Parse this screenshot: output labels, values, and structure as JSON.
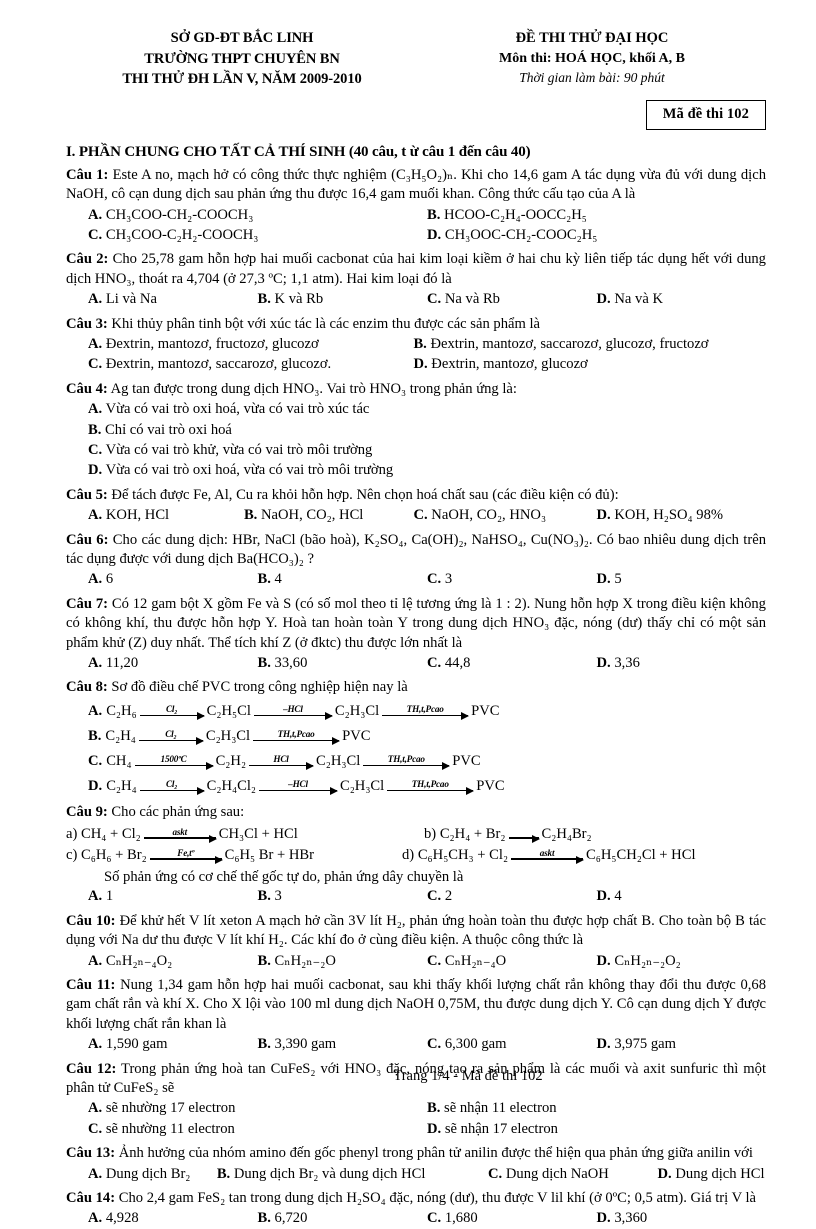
{
  "header": {
    "left": [
      "SỞ GD-ĐT BẮC LINH",
      "TRƯỜNG THPT CHUYÊN BN",
      "THI THỬ ĐH LẦN V, NĂM 2009-2010"
    ],
    "right_title": "ĐỀ THI THỬ ĐẠI HỌC",
    "right_subject": "Môn thi: HOÁ HỌC, khối A, B",
    "right_time": "Thời gian làm bài: 90 phút",
    "exam_code": "Mã đề thi 102"
  },
  "section_title": "I. PHẦN CHUNG CHO TẤT CẢ THÍ SINH (40 câu, t ừ câu 1 đến câu 40)",
  "questions": [
    {
      "label": "Câu 1:",
      "stem": "Este A no, mạch hở có công thức thực nghiệm (C₃H₅O₂)ₙ. Khi cho 14,6 gam A tác dụng vừa đủ với dung dịch NaOH, cô cạn dung dịch sau phản ứng thu được 16,4 gam muối khan. Công thức cấu tạo của A là",
      "options": [
        {
          "letter": "A.",
          "text": "CH₃COO-CH₂-COOCH₃"
        },
        {
          "letter": "B.",
          "text": "HCOO-C₂H₄-OOCC₂H₅"
        },
        {
          "letter": "C.",
          "text": "CH₃COO-C₂H₂-COOCH₃"
        },
        {
          "letter": "D.",
          "text": "CH₃OOC-CH₂-COOC₂H₅"
        }
      ]
    },
    {
      "label": "Câu 2:",
      "stem": "Cho 25,78 gam hỗn hợp hai muối cacbonat của hai kim loại kiềm ở hai chu kỳ liên tiếp tác dụng hết với dung dịch HNO₃, thoát ra 4,704 (ở 27,3 ºC; 1,1 atm). Hai kim loại đó là",
      "options": [
        {
          "letter": "A.",
          "text": "Li và Na"
        },
        {
          "letter": "B.",
          "text": "K và Rb"
        },
        {
          "letter": "C.",
          "text": "Na và Rb"
        },
        {
          "letter": "D.",
          "text": "Na và K"
        }
      ]
    },
    {
      "label": "Câu 3:",
      "stem": "Khi thủy phân tinh bột với xúc tác là các enzim thu được các sản phẩm là",
      "options": [
        {
          "letter": "A.",
          "text": "Đextrin, mantozơ, fructozơ, glucozơ"
        },
        {
          "letter": "B.",
          "text": "Đextrin, mantozơ, saccarozơ, glucozơ, fructozơ"
        },
        {
          "letter": "C.",
          "text": "Đextrin, mantozơ, saccarozơ, glucozơ."
        },
        {
          "letter": "D.",
          "text": "Đextrin, mantozơ, glucozơ"
        }
      ]
    },
    {
      "label": "Câu 4:",
      "stem": "Ag tan được trong dung dịch HNO₃. Vai trò HNO₃ trong phản ứng là:",
      "options": [
        {
          "letter": "A.",
          "text": "Vừa có vai trò oxi hoá, vừa có vai trò xúc tác"
        },
        {
          "letter": "B.",
          "text": "Chỉ có vai trò oxi hoá"
        },
        {
          "letter": "C.",
          "text": "Vừa có vai trò khử, vừa có vai trò môi trường"
        },
        {
          "letter": "D.",
          "text": "Vừa có vai trò oxi hoá, vừa có vai trò môi trường"
        }
      ]
    },
    {
      "label": "Câu 5:",
      "stem": "Để tách được Fe, Al, Cu ra khỏi hỗn hợp. Nên chọn hoá chất sau (các điều kiện có đủ):",
      "options": [
        {
          "letter": "A.",
          "text": "KOH, HCl"
        },
        {
          "letter": "B.",
          "text": "NaOH, CO₂, HCl"
        },
        {
          "letter": "C.",
          "text": "NaOH, CO₂, HNO₃"
        },
        {
          "letter": "D.",
          "text": "KOH, H₂SO₄ 98%"
        }
      ]
    },
    {
      "label": "Câu 6:",
      "stem": "Cho các dung dịch: HBr, NaCl (bão hoà), K₂SO₄, Ca(OH)₂, NaHSO₄, Cu(NO₃)₂. Có bao nhiêu dung dịch trên tác dụng được với dung dịch Ba(HCO₃)₂ ?",
      "options": [
        {
          "letter": "A.",
          "text": "6"
        },
        {
          "letter": "B.",
          "text": "4"
        },
        {
          "letter": "C.",
          "text": "3"
        },
        {
          "letter": "D.",
          "text": "5"
        }
      ]
    },
    {
      "label": "Câu 7:",
      "stem": "Có 12 gam bột X gồm Fe và S (có số mol theo tỉ lệ tương ứng là 1 : 2). Nung hỗn hợp X trong điều kiện không có không khí, thu được hỗn hợp Y. Hoà tan hoàn toàn Y trong dung dịch HNO₃ đặc, nóng (dư) thấy chỉ có một sản phẩm khử (Z) duy nhất. Thể tích khí Z (ở đktc) thu được lớn nhất là",
      "options": [
        {
          "letter": "A.",
          "text": "11,20"
        },
        {
          "letter": "B.",
          "text": "33,60"
        },
        {
          "letter": "C.",
          "text": "44,8"
        },
        {
          "letter": "D.",
          "text": "3,36"
        }
      ]
    },
    {
      "label": "Câu 8:",
      "stem": "Sơ đồ điều chế PVC trong công nghiệp hiện nay là"
    },
    {
      "label": "Câu 9:",
      "stem": "Cho các phản ứng sau:",
      "tail": "Số phản ứng có cơ chế thế gốc tự do, phản ứng dây chuyền là",
      "options": [
        {
          "letter": "A.",
          "text": "1"
        },
        {
          "letter": "B.",
          "text": "3"
        },
        {
          "letter": "C.",
          "text": "2"
        },
        {
          "letter": "D.",
          "text": "4"
        }
      ]
    },
    {
      "label": "Câu 10:",
      "stem": "Để khử hết V lít xeton A mạch hở cần 3V lít H₂, phản ứng hoàn toàn thu được hợp chất B. Cho  toàn bộ B tác dụng với Na dư thu được V lít khí H₂. Các khí đo ở cùng điều kiện. A thuộc công thức là",
      "options": [
        {
          "letter": "A.",
          "text": "CₙH₂ₙ₋₄O₂"
        },
        {
          "letter": "B.",
          "text": "CₙH₂ₙ₋₂O"
        },
        {
          "letter": "C.",
          "text": "CₙH₂ₙ₋₄O"
        },
        {
          "letter": "D.",
          "text": "CₙH₂ₙ₋₂O₂"
        }
      ]
    },
    {
      "label": "Câu 11:",
      "stem": "Nung 1,34 gam hỗn hợp hai muối cacbonat, sau khi thấy khối lượng chất rắn không thay đổi thu được 0,68 gam chất rắn và khí X. Cho X lội vào 100 ml dung dịch NaOH 0,75M, thu được dung dịch Y. Cô cạn dung dịch Y được khối lượng chất rắn khan là",
      "options": [
        {
          "letter": "A.",
          "text": "1,590 gam"
        },
        {
          "letter": "B.",
          "text": "3,390 gam"
        },
        {
          "letter": "C.",
          "text": "6,300 gam"
        },
        {
          "letter": "D.",
          "text": "3,975 gam"
        }
      ]
    },
    {
      "label": "Câu 12:",
      "stem": "Trong phản ứng hoà tan CuFeS₂ với HNO₃ đặc, nóng tạo ra sản phẩm là các muối và axit sunfuric thì một phân tử CuFeS₂ sẽ",
      "options": [
        {
          "letter": "A.",
          "text": "sẽ nhường 17 electron"
        },
        {
          "letter": "B.",
          "text": "sẽ nhận 11 electron"
        },
        {
          "letter": "C.",
          "text": "sẽ nhường 11 electron"
        },
        {
          "letter": "D.",
          "text": "sẽ nhận 17 electron"
        }
      ]
    },
    {
      "label": "Câu 13:",
      "stem": "Ảnh hưởng của nhóm amino đến gốc phenyl trong phân tử anilin được thể hiện qua phản ứng giữa anilin  với",
      "options": [
        {
          "letter": "A.",
          "text": "Dung dịch Br₂"
        },
        {
          "letter": "B.",
          "text": "Dung dịch Br₂ và dung dịch HCl"
        },
        {
          "letter": "C.",
          "text": "Dung dịch NaOH"
        },
        {
          "letter": "D.",
          "text": "Dung dịch HCl"
        }
      ]
    },
    {
      "label": "Câu 14:",
      "stem": "Cho 2,4 gam FeS₂ tan trong dung dịch H₂SO₄ đặc, nóng (dư), thu được V lil khí (ở 0ºC; 0,5 atm). Giá trị V là",
      "options": [
        {
          "letter": "A.",
          "text": "4,928"
        },
        {
          "letter": "B.",
          "text": "6,720"
        },
        {
          "letter": "C.",
          "text": "1,680"
        },
        {
          "letter": "D.",
          "text": "3,360"
        }
      ]
    }
  ],
  "pvc_scheme": {
    "rows": [
      {
        "letter": "A.",
        "steps": [
          {
            "species": "C₂H₆",
            "arrow": "Cl₂",
            "width": "a64"
          },
          {
            "species": "C₂H₅Cl",
            "arrow": "–HCl",
            "width": "a78"
          },
          {
            "species": "C₂H₃Cl",
            "arrow": "TH,t,Pcao",
            "width": "a86"
          },
          {
            "species": "PVC"
          }
        ]
      },
      {
        "letter": "B.",
        "steps": [
          {
            "species": "C₂H₄",
            "arrow": "Cl₂",
            "width": "a64"
          },
          {
            "species": "C₂H₃Cl",
            "arrow": "TH,t,Pcao",
            "width": "a86"
          },
          {
            "species": "PVC"
          }
        ]
      },
      {
        "letter": "C.",
        "steps": [
          {
            "species": "CH₄",
            "arrow": "1500ºC",
            "width": "a78"
          },
          {
            "species": "C₂H₂",
            "arrow": "HCl",
            "width": "a64"
          },
          {
            "species": "C₂H₃Cl",
            "arrow": "TH,t,Pcao",
            "width": "a86"
          },
          {
            "species": "PVC"
          }
        ]
      },
      {
        "letter": "D.",
        "steps": [
          {
            "species": "C₂H₄",
            "arrow": "Cl₂",
            "width": "a64"
          },
          {
            "species": "C₂H₄Cl₂",
            "arrow": "–HCl",
            "width": "a78"
          },
          {
            "species": "C₂H₃Cl",
            "arrow": "TH,t,Pcao",
            "width": "a86"
          },
          {
            "species": "PVC"
          }
        ]
      }
    ]
  },
  "q9_reactions": {
    "a_label": "a)",
    "a_left": "CH₄  + Cl₂",
    "a_arrow": "askt",
    "a_right": "CH₃Cl + HCl",
    "b_label": "b)",
    "b_left": "C₂H₄ + Br₂",
    "b_arrow": "",
    "b_right": "C₂H₄Br₂",
    "c_label": "c)",
    "c_left": "C₆H₆ + Br₂",
    "c_arrow": "Fe,tº",
    "c_right": "C₆H₅ Br + HBr",
    "d_label": "d)",
    "d_left": "C₆H₅CH₃ + Cl₂",
    "d_arrow": "askt",
    "d_right": "C₆H₅CH₂Cl + HCl"
  },
  "footer": "Trang 1/4 - Mã đề thi 102"
}
